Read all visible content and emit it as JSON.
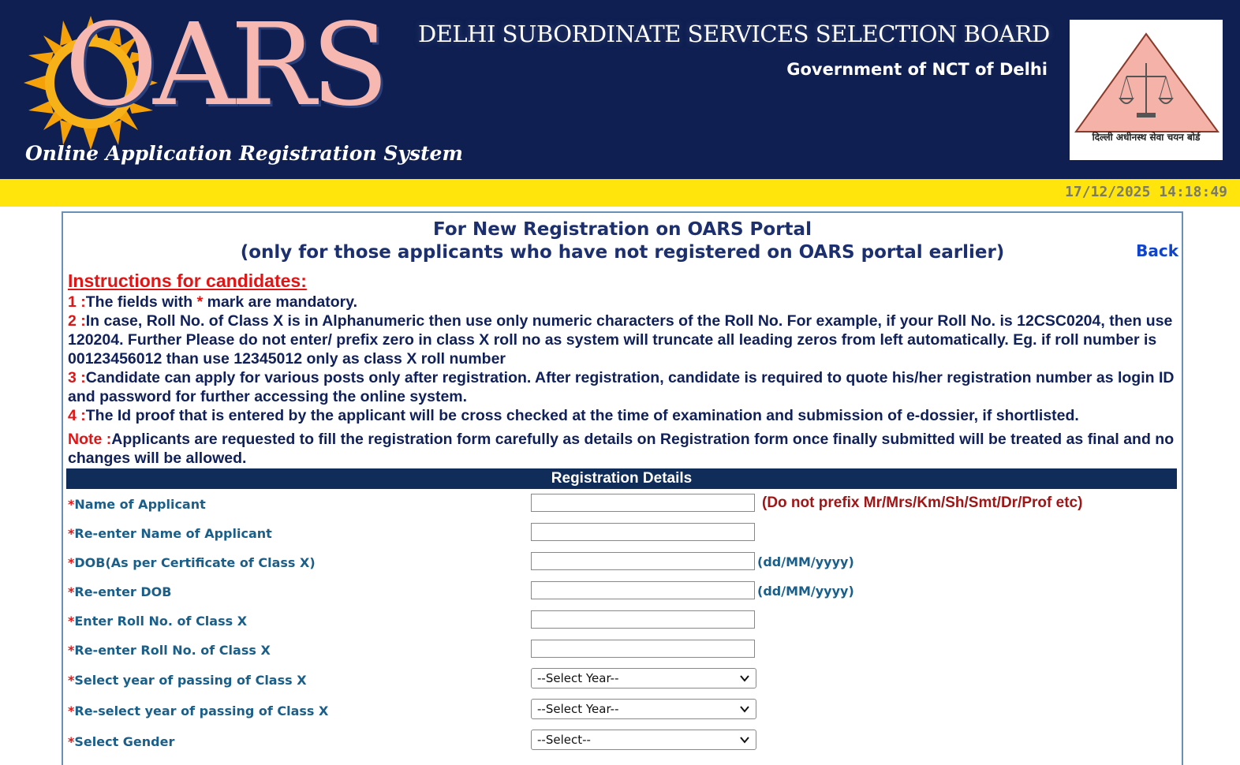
{
  "header": {
    "logo_text": "OARS",
    "tagline": "Online Application Registration System",
    "board_title": "DELHI SUBORDINATE SERVICES SELECTION BOARD",
    "government": "Government of NCT of Delhi",
    "seal_text": "दिल्ली अधीनस्थ सेवा चयन बोर्ड"
  },
  "status": {
    "datetime": "17/12/2025 14:18:49"
  },
  "page": {
    "title_line1": "For New Registration on OARS Portal",
    "title_line2": "(only for those applicants who have not registered on OARS portal earlier)",
    "back_label": "Back"
  },
  "instructions": {
    "heading": "Instructions for candidates:",
    "items": [
      {
        "num": "1 :",
        "pre": "The fields with ",
        "star": "*",
        "post": " mark are mandatory."
      },
      {
        "num": "2 :",
        "text": "In case, Roll No. of Class X is in Alphanumeric then use only numeric characters of the Roll No. For example, if your Roll No. is 12CSC0204, then use 120204. Further Please do not enter/ prefix zero in class X roll no as system will truncate all leading zeros from left automatically. Eg. if roll number is 00123456012 than use 12345012 only as class X roll number"
      },
      {
        "num": "3 :",
        "text": "Candidate can apply for various posts only after registration. After registration, candidate is required to quote his/her registration number as login ID and password for further accessing the online system."
      },
      {
        "num": "4 :",
        "text": "The Id proof that is entered by the applicant will be cross checked at the time of examination and submission of e-dossier, if shortlisted."
      }
    ],
    "note_label": "Note :",
    "note_text": "Applicants are requested to fill the registration form carefully as details on Registration form once finally submitted will be treated as final and no changes will be allowed."
  },
  "registration": {
    "heading": "Registration Details",
    "required_mark": "*",
    "fields": [
      {
        "label": "Name of Applicant",
        "hint": "(Do not prefix Mr/Mrs/Km/Sh/Smt/Dr/Prof etc)",
        "value": ""
      },
      {
        "label": "Re-enter Name of Applicant",
        "value": ""
      },
      {
        "label": "DOB(As per Certificate of Class X)",
        "hint": "(dd/MM/yyyy)",
        "value": ""
      },
      {
        "label": "Re-enter DOB",
        "hint": "(dd/MM/yyyy)",
        "value": ""
      },
      {
        "label": "Enter Roll No. of Class X",
        "value": ""
      },
      {
        "label": "Re-enter Roll No. of Class X",
        "value": ""
      },
      {
        "label": "Select year of passing of Class X",
        "selected": "--Select Year--"
      },
      {
        "label": "Re-select year of passing of Class X",
        "selected": "--Select Year--"
      },
      {
        "label": "Select Gender",
        "selected": "--Select--"
      }
    ]
  }
}
